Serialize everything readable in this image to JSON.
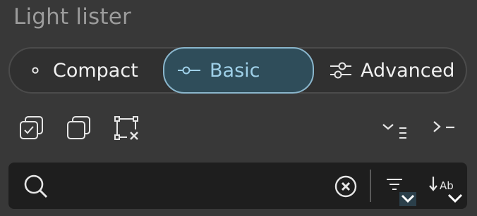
{
  "panel": {
    "title": "Light lister"
  },
  "modes": {
    "compact": "Compact",
    "basic": "Basic",
    "advanced": "Advanced",
    "selected": "Basic"
  },
  "toolbar": {
    "icons": [
      "check-all-icon",
      "copy-icon",
      "deselect-icon",
      "expand-all-icon",
      "console-icon"
    ]
  },
  "search": {
    "value": "",
    "placeholder": "",
    "sort_label": "Ab"
  },
  "colors": {
    "accent": "#8ab6cc",
    "accent_fill": "#2f4d5a",
    "background": "#383838",
    "search_bg": "#1e1e1e"
  }
}
